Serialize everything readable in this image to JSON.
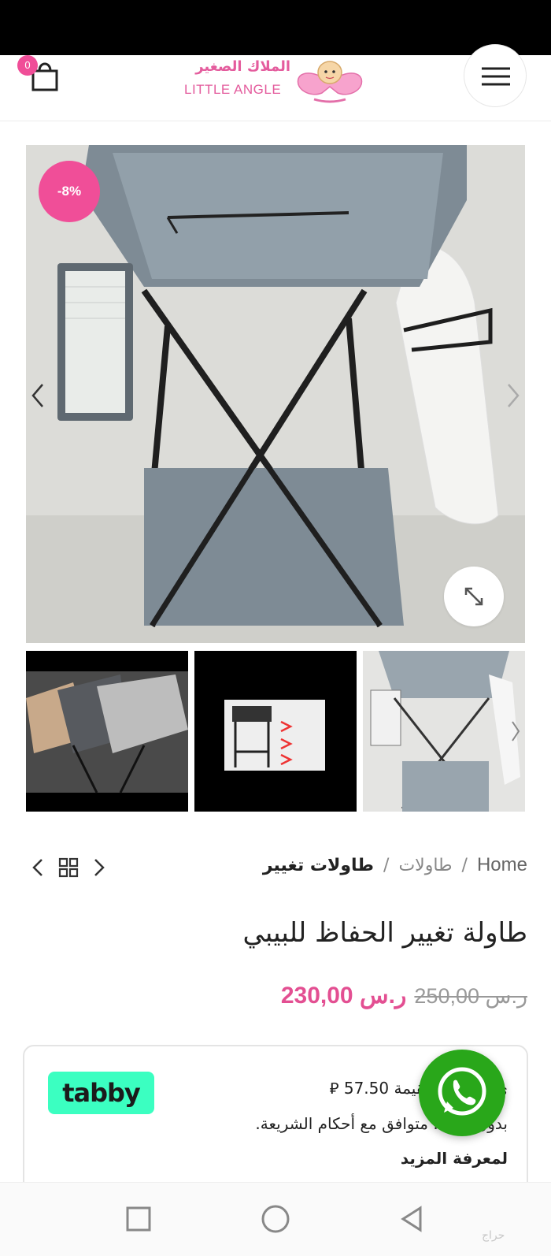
{
  "header": {
    "cart_count": "0",
    "logo_ar": "الملاك الصغير",
    "logo_en": "LITTLE ANGLE"
  },
  "product": {
    "sale_badge": "-8%",
    "title": "طاولة تغيير الحفاظ للبيبي",
    "price_old": "250,00 ر.س",
    "price_new": "230,00 ر.س"
  },
  "breadcrumb": {
    "home": "Home",
    "separator": "/",
    "category": "طاولات",
    "current": "طاولات تغيير"
  },
  "tabby": {
    "logo": "tabby",
    "line1": "ى 4 دفعات بقيمة 57.50 ⃁",
    "line2": "بدون فوائد. متوافق مع أحكام الشريعة.",
    "learn_more": "لمعرفة المزيد"
  },
  "watermark": "حراج",
  "colors": {
    "accent_pink": "#f04e98",
    "price_pink": "#e34f92",
    "tabby_green": "#3bffc1",
    "whatsapp_green": "#29a71a"
  },
  "icons": {
    "cart": "shopping-bag-icon",
    "menu": "hamburger-icon",
    "zoom": "expand-icon",
    "prev": "chevron-left-icon",
    "next": "chevron-right-icon",
    "grid": "grid-icon",
    "whatsapp": "whatsapp-icon"
  }
}
